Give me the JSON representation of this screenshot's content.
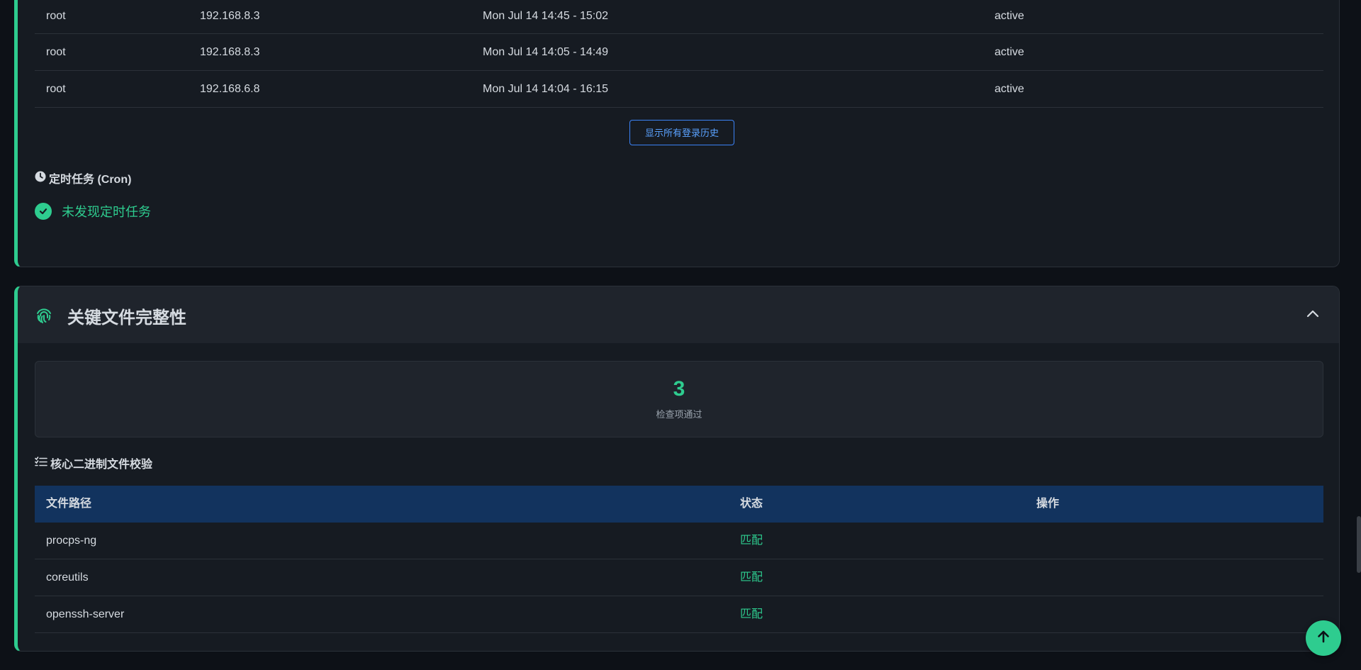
{
  "logins": {
    "rows": [
      {
        "user": "root",
        "ip": "192.168.8.3",
        "time": "Mon Jul 14 14:45 - 15:02",
        "status": "active"
      },
      {
        "user": "root",
        "ip": "192.168.8.3",
        "time": "Mon Jul 14 14:05 - 14:49",
        "status": "active"
      },
      {
        "user": "root",
        "ip": "192.168.6.8",
        "time": "Mon Jul 14 14:04 - 16:15",
        "status": "active"
      }
    ],
    "show_all_label": "显示所有登录历史"
  },
  "cron": {
    "title": "定时任务 (Cron)",
    "status_text": "未发现定时任务",
    "icon": "clock-icon"
  },
  "integrity": {
    "title": "关键文件完整性",
    "icon": "fingerprint-icon",
    "stat": {
      "value": "3",
      "label": "检查项通过"
    },
    "binaries_title": "核心二进制文件校验",
    "table": {
      "headers": [
        "文件路径",
        "状态",
        "操作"
      ],
      "rows": [
        {
          "path": "procps-ng",
          "state": "匹配",
          "op": ""
        },
        {
          "path": "coreutils",
          "state": "匹配",
          "op": ""
        },
        {
          "path": "openssh-server",
          "state": "匹配",
          "op": ""
        }
      ]
    }
  },
  "colors": {
    "accent": "#2ecc8f",
    "table_header": "#12335e",
    "link_blue": "#5aa2ff",
    "background": "#0d1117",
    "card": "#161b22"
  }
}
